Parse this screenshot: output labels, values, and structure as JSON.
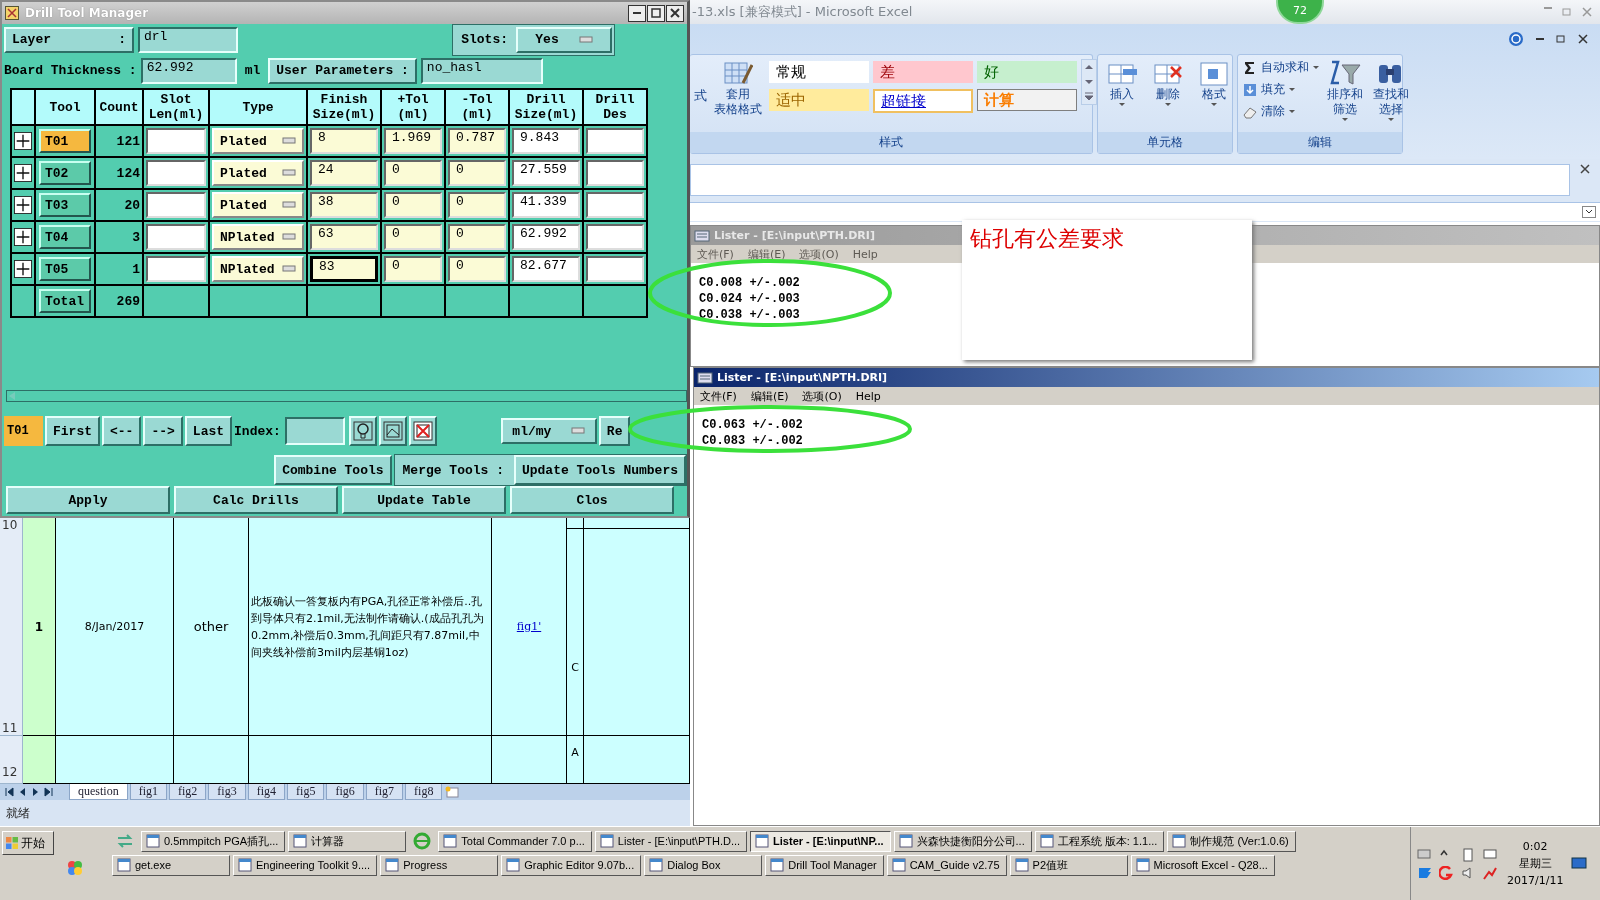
{
  "drill_tool_manager": {
    "title": "Drill Tool Manager",
    "layer": {
      "label": "Layer",
      "separator": ":",
      "value": "drl"
    },
    "slots": {
      "label": "Slots:",
      "value": "Yes"
    },
    "board_thickness": {
      "label": "Board Thickness :",
      "value": "62.992",
      "unit": "ml"
    },
    "user_parameters": {
      "label": "User Parameters :",
      "value": "no_hasl"
    },
    "columns": [
      "Tool",
      "Count",
      "Slot Len(ml)",
      "Type",
      "Finish Size(ml)",
      "+Tol (ml)",
      "-Tol (ml)",
      "Drill Size(ml)",
      "Drill Des"
    ],
    "rows": [
      {
        "tool": "T01",
        "selected": true,
        "count": "121",
        "type": "Plated",
        "finish": "8",
        "focused": false,
        "plus_tol": "1.969",
        "minus_tol": "0.787",
        "drill_size": "9.843"
      },
      {
        "tool": "T02",
        "selected": false,
        "count": "124",
        "type": "Plated",
        "finish": "24",
        "focused": false,
        "plus_tol": "0",
        "minus_tol": "0",
        "drill_size": "27.559"
      },
      {
        "tool": "T03",
        "selected": false,
        "count": "20",
        "type": "Plated",
        "finish": "38",
        "focused": false,
        "plus_tol": "0",
        "minus_tol": "0",
        "drill_size": "41.339"
      },
      {
        "tool": "T04",
        "selected": false,
        "count": "3",
        "type": "NPlated",
        "finish": "63",
        "focused": false,
        "plus_tol": "0",
        "minus_tol": "0",
        "drill_size": "62.992"
      },
      {
        "tool": "T05",
        "selected": false,
        "count": "1",
        "type": "NPlated",
        "finish": "83",
        "focused": true,
        "plus_tol": "0",
        "minus_tol": "0",
        "drill_size": "82.677"
      }
    ],
    "total": {
      "label": "Total",
      "count": "269"
    },
    "navigation": {
      "current": "T01",
      "buttons": [
        "First",
        "<--",
        "-->",
        "Last"
      ],
      "index_label": "Index:",
      "units": "ml/my",
      "extra": "Re"
    },
    "tool_actions": {
      "combine": "Combine Tools",
      "merge_label": "Merge Tools :",
      "update_numbers": "Update Tools Numbers"
    },
    "buttons": [
      "Apply",
      "Calc Drills",
      "Update Table",
      "Clos"
    ]
  },
  "excel": {
    "title": "-13.xls  [兼容模式] - Microsoft Excel",
    "badge": "72",
    "ribbon": {
      "cut_label": "式",
      "table_format": [
        "套用",
        "表格格式"
      ],
      "styles": [
        {
          "label": "常规",
          "kind": "normal"
        },
        {
          "label": "差",
          "kind": "bad"
        },
        {
          "label": "好",
          "kind": "good"
        },
        {
          "label": "适中",
          "kind": "neutral"
        },
        {
          "label": "超链接",
          "kind": "link"
        },
        {
          "label": "计算",
          "kind": "calc"
        }
      ],
      "styles_group": "样式",
      "cells": [
        "插入",
        "删除",
        "格式"
      ],
      "cells_group": "单元格",
      "editing": [
        "自动求和",
        "填充",
        "清除"
      ],
      "sort": [
        "排序和",
        "筛选"
      ],
      "find": [
        "查找和",
        "选择"
      ],
      "editing_group": "编辑"
    },
    "sheet": {
      "row_numbers": [
        "10",
        "11",
        "12"
      ],
      "row": {
        "number": "1",
        "date": "8/Jan/2017",
        "category": "other",
        "description": "此板确认一答复板内有PGA,孔径正常补偿后..孔到导体只有2.1mil,无法制作请确认.(成品孔孔为0.2mm,补偿后0.3mm,孔间距只有7.87mil,中间夹线补偿前3mil内层基铜1oz)",
        "link": "fig1'",
        "column_6": "C"
      },
      "next_row": {
        "column_6": "A"
      },
      "tabs": [
        {
          "label": "question",
          "selected": true
        },
        {
          "label": "fig1",
          "selected": false
        },
        {
          "label": "fig2",
          "selected": false
        },
        {
          "label": "fig3",
          "selected": false
        },
        {
          "label": "fig4",
          "selected": false
        },
        {
          "label": "fig5",
          "selected": false
        },
        {
          "label": "fig6",
          "selected": false
        },
        {
          "label": "fig7",
          "selected": false
        },
        {
          "label": "fig8",
          "selected": false
        }
      ],
      "status": "就绪"
    }
  },
  "listers": [
    {
      "title": "Lister - [E:\\input\\PTH.DRI]",
      "active": false,
      "menu": [
        "文件(F)",
        "编辑(E)",
        "选项(O)",
        "Help"
      ],
      "lines": [
        "C0.008 +/-.002",
        "C0.024 +/-.003",
        "C0.038 +/-.003"
      ]
    },
    {
      "title": "Lister - [E:\\input\\NPTH.DRI]",
      "active": true,
      "menu": [
        "文件(F)",
        "编辑(E)",
        "选项(O)",
        "Help"
      ],
      "lines": [
        "C0.063 +/-.002",
        "C0.083 +/-.002"
      ]
    }
  ],
  "note": {
    "text": "钻孔有公差要求"
  },
  "taskbar": {
    "start": "开始",
    "row_1": [
      {
        "label": "0.5mmpitch PGA插孔...",
        "selected": false
      },
      {
        "label": "计算器",
        "selected": false
      },
      {
        "label": "Total Commander 7.0 p...",
        "selected": false
      },
      {
        "label": "Lister - [E:\\input\\PTH.D...",
        "selected": false
      },
      {
        "label": "Lister - [E:\\input\\NP...",
        "selected": true
      },
      {
        "label": "兴森快捷衡阳分公司...",
        "selected": false
      },
      {
        "label": "工程系统  版本: 1.1...",
        "selected": false
      },
      {
        "label": "制作规范 (Ver:1.0.6)",
        "selected": false
      }
    ],
    "row_2": [
      {
        "label": "get.exe",
        "selected": false
      },
      {
        "label": "Engineering Toolkit 9....",
        "selected": false
      },
      {
        "label": "Progress",
        "selected": false
      },
      {
        "label": "Graphic Editor 9.07b...",
        "selected": false
      },
      {
        "label": "Dialog Box",
        "selected": false
      },
      {
        "label": "Drill Tool Manager",
        "selected": false
      },
      {
        "label": "CAM_Guide v2.75",
        "selected": false
      },
      {
        "label": "P2值班",
        "selected": false
      },
      {
        "label": "Microsoft Excel - Q28...",
        "selected": false
      }
    ],
    "clock": {
      "time": "0:02",
      "weekday": "星期三",
      "date": "2017/1/11"
    }
  }
}
